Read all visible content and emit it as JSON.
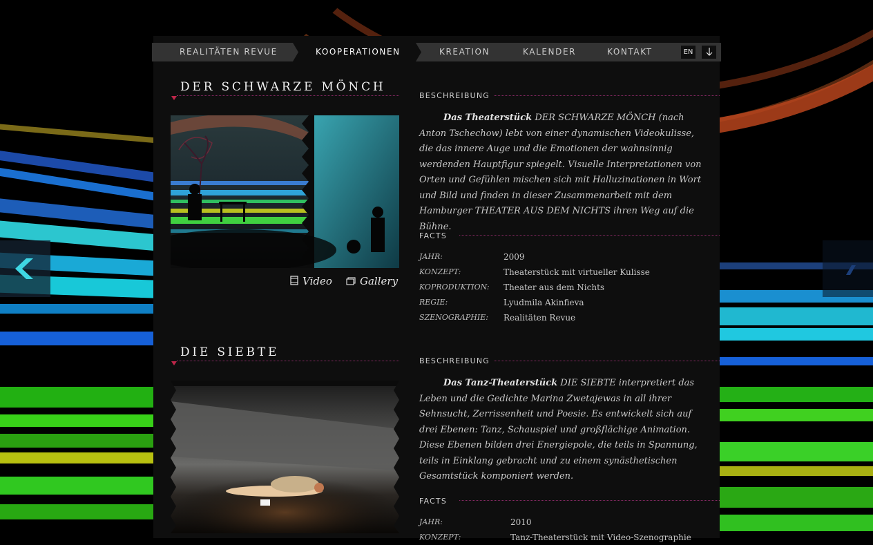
{
  "nav": {
    "items": [
      "REALITÄTEN REVUE",
      "KOOPERATIONEN",
      "KREATION",
      "KALENDER",
      "KONTAKT"
    ],
    "active": "KOOPERATIONEN",
    "lang": "EN"
  },
  "colors": {
    "panel": "#0e0e0e",
    "nav_bg": "#333333",
    "accent": "#c0264a",
    "dotline": "#8a2a66"
  },
  "projects": [
    {
      "title": "DER SCHWARZE MÖNCH",
      "beschreibung_label": "BESCHREIBUNG",
      "intro": "Das Theaterstück",
      "description": "DER SCHWARZE MÖNCH (nach Anton Tschechow) lebt von einer dynamischen Videokulisse, die das innere Auge und die Emotionen der wahnsinnig werdenden Hauptfigur spiegelt. Visuelle Interpretationen von Orten und Gefühlen mischen sich mit Halluzinationen in Wort und Bild und finden in dieser Zusammenarbeit mit dem Hamburger THEATER AUS DEM NICHTS ihren Weg auf die Bühne.",
      "facts_label": "FACTS",
      "facts": [
        {
          "key": "JAHR:",
          "value": "2009"
        },
        {
          "key": "KONZEPT:",
          "value": "Theaterstück mit virtueller Kulisse"
        },
        {
          "key": "KOPRODUKTION:",
          "value": "Theater aus dem Nichts"
        },
        {
          "key": "REGIE:",
          "value": "Lyudmila Akinfieva"
        },
        {
          "key": "SZENOGRAPHIE:",
          "value": "Realitäten Revue"
        }
      ],
      "video_label": "Video",
      "gallery_label": "Gallery"
    },
    {
      "title": "DIE SIEBTE",
      "beschreibung_label": "BESCHREIBUNG",
      "intro": "Das Tanz-Theaterstück",
      "description": "DIE SIEBTE interpretiert das Leben und die Gedichte Marina Zwetajewas in all ihrer Sehnsucht, Zerrissenheit und Poesie. Es entwickelt sich auf drei Ebenen: Tanz, Schauspiel und großflächige Animation. Diese Ebenen bilden drei Energiepole, die teils in Spannung, teils in Einklang gebracht und zu einem synästhetischen Gesamtstück komponiert werden.",
      "facts_label": "FACTS",
      "facts": [
        {
          "key": "JAHR:",
          "value": "2010"
        },
        {
          "key": "KONZEPT:",
          "value": "Tanz-Theaterstück mit Video-Szenographie"
        }
      ]
    }
  ]
}
